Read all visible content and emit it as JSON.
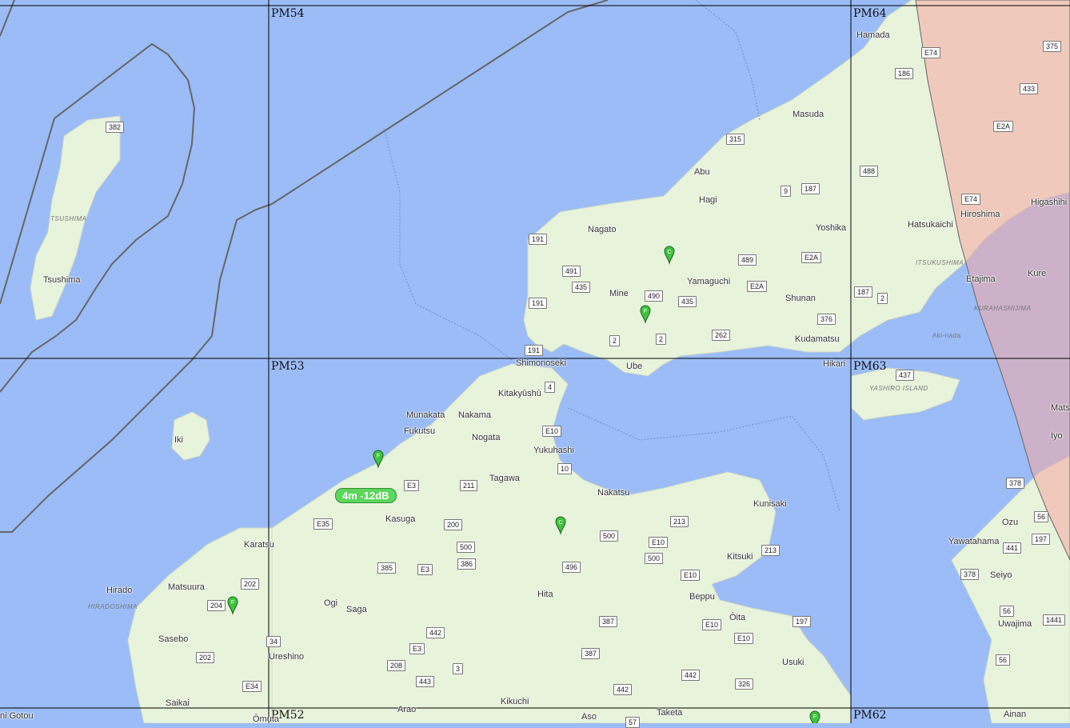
{
  "grid": {
    "squares": [
      "PM54",
      "PM64",
      "PM53",
      "PM63",
      "PM52",
      "PM62"
    ]
  },
  "cities": [
    "Hamada",
    "Masuda",
    "Abu",
    "Hagi",
    "Nagato",
    "Yoshika",
    "Hatsukaichi",
    "Hiroshima",
    "Higashihi",
    "Mine",
    "Yamaguchi",
    "Shunan",
    "Etajima",
    "Kure",
    "Kudamatsu",
    "Ube",
    "Shimonoseki",
    "Hikari",
    "Tsushima",
    "Kitakyushu",
    "Munakata",
    "Nakama",
    "Fukutsu",
    "Nogata",
    "Yukuhashi",
    "Iki",
    "Tagawa",
    "Nakatsu",
    "Kunisaki",
    "Kasuga",
    "Karatsu",
    "Kitsuki",
    "Hirado",
    "Matsuura",
    "Ozu",
    "Yawatahama",
    "Hita",
    "Beppu",
    "Ogi",
    "Saga",
    "Seiyo",
    "Oita",
    "Uwajima",
    "Sasebo",
    "Ureshino",
    "Usuki",
    "Saikai",
    "Arao",
    "Kikuchi",
    "Aso",
    "Taketa",
    "Omuta",
    "Ainan",
    "Iyo",
    "Mats",
    "Gotou"
  ],
  "city_text": {
    "Kitakyushu": "Kitakyūshū",
    "Oita": "Ōita",
    "Omuta": "Ōmuta",
    "Gotou": "ni Gotou"
  },
  "islands": [
    "TSUSHIMA",
    "ITSUKUSHIMA",
    "KURAHASHIJIMA",
    "YASHIRO ISLAND",
    "HIRADOSHIMA",
    "Aki-nada"
  ],
  "routes": [
    "382",
    "E74",
    "375",
    "186",
    "433",
    "315",
    "E2A",
    "488",
    "187",
    "9",
    "E74",
    "191",
    "491",
    "489",
    "E2A",
    "435",
    "490",
    "435",
    "191",
    "E2A",
    "187",
    "2",
    "376",
    "262",
    "2",
    "2",
    "191",
    "437",
    "4",
    "E10",
    "10",
    "E3",
    "211",
    "213",
    "378",
    "500",
    "E35",
    "200",
    "E10",
    "213",
    "56",
    "500",
    "500",
    "197",
    "385",
    "E3",
    "386",
    "496",
    "441",
    "E10",
    "378",
    "202",
    "204",
    "387",
    "E10",
    "56",
    "34",
    "442",
    "E10",
    "197",
    "1441",
    "E3",
    "387",
    "202",
    "208",
    "3",
    "56",
    "326",
    "442",
    "443",
    "442",
    "E34",
    "57"
  ],
  "spots": [
    {
      "label": "4m -12dB",
      "color": "#5cd65c"
    }
  ],
  "markers": [
    {
      "letter": "C"
    },
    {
      "letter": "F"
    },
    {
      "letter": "F"
    },
    {
      "letter": "C"
    },
    {
      "letter": "F"
    },
    {
      "letter": "F"
    }
  ],
  "colors": {
    "water": "#9bbcf7",
    "land": "#e8f3dc",
    "grid_line": "#000000",
    "boundary": "#555555",
    "range_fill": "#f4a7a2",
    "spot_bg": "#5cd65c"
  }
}
